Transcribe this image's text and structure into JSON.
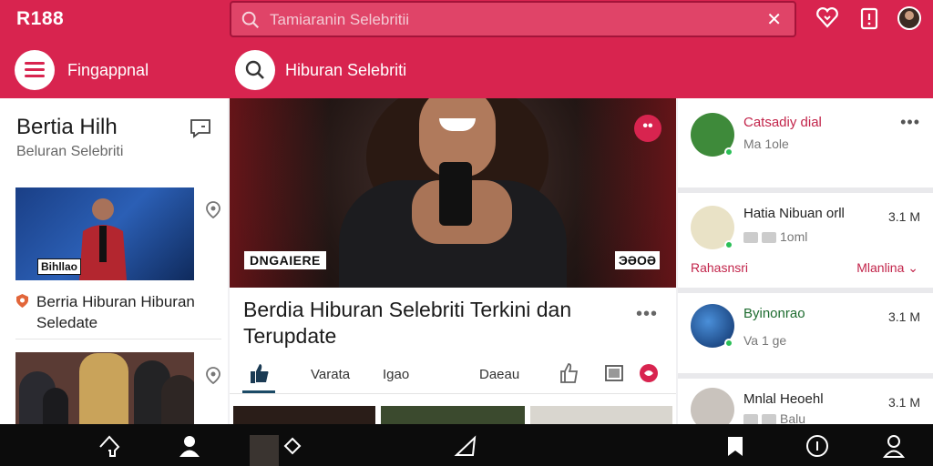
{
  "header": {
    "brand": "R188",
    "search_placeholder": "Tamiaranin Selebritii",
    "menu_label": "Fingappnal",
    "search_label": "Hiburan Selebriti"
  },
  "left": {
    "title": "Bertia Hilh",
    "subtitle": "Beluran Selebriti",
    "card1_tag": "Bihllao",
    "card1_caption": "Berria Hiburan Hiburan Seledate"
  },
  "middle": {
    "hero_badge_left": "DNGAIERE",
    "hero_badge_right": "ЭӘОӘ",
    "hero_menu": "••",
    "article_title": "Berdia Hiburan Selebriti Terkini dan Terupdate",
    "article_more": "•••",
    "tabs": [
      "Varata",
      "Igao",
      "Daeau"
    ]
  },
  "right": {
    "items": [
      {
        "name": "Catsadiy dial",
        "sub": "Ma 1ole",
        "more": "•••"
      },
      {
        "name": "Hatia Nibuan orll",
        "count": "3.1 M",
        "meta": "1oml",
        "link_left": "Rahasnsri",
        "link_right": "Mlanlina"
      },
      {
        "name": "Byinonrao",
        "count": "3.1 M",
        "sub": "Va 1 ge"
      },
      {
        "name": "Mnlal Heoehl",
        "count": "3.1 M",
        "meta": "Balu"
      }
    ]
  },
  "colors": {
    "primary": "#d8244f",
    "accent_link": "#c2244a",
    "online": "#2bbf57",
    "bottom_bar": "#0c0c0c"
  }
}
